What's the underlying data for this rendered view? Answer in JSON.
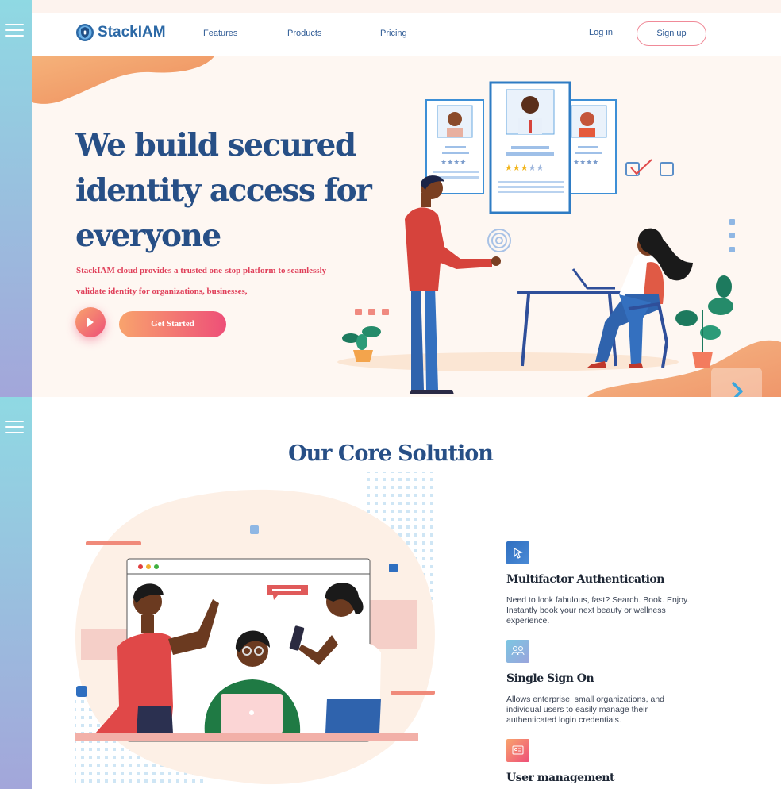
{
  "brand": {
    "name": "StackIAM",
    "logo_icon": "shield-icon"
  },
  "nav": {
    "links": [
      "Features",
      "Products",
      "Pricing"
    ],
    "login_label": "Log in",
    "signup_label": "Sign up"
  },
  "hero": {
    "title": "We build secured identity access for everyone",
    "description": "StackIAM cloud provides a trusted one-stop platform to seamlessly validate identity for organizations, businesses,",
    "cta_label": "Get Started",
    "play_icon": "play-icon",
    "next_icon": "chevron-right-icon"
  },
  "core": {
    "title": "Our Core Solution",
    "features": [
      {
        "title": "Multifactor Authentication",
        "description": "Need to look fabulous, fast? Search. Book. Enjoy. Instantly book your next beauty or wellness experience.",
        "icon": "cursor-icon"
      },
      {
        "title": "Single Sign On",
        "description": "Allows enterprise, small organizations, and individual users to easily manage their authenticated login credentials.",
        "icon": "users-icon"
      },
      {
        "title": "User management",
        "icon": "id-card-icon"
      }
    ]
  },
  "colors": {
    "primary": "#274f86",
    "accent": "#ee4f78",
    "accent_light": "#f8a36d",
    "hero_bg": "#fef7f2",
    "sidebar_top": "#8fd9e3",
    "sidebar_bottom": "#a3a6da"
  }
}
